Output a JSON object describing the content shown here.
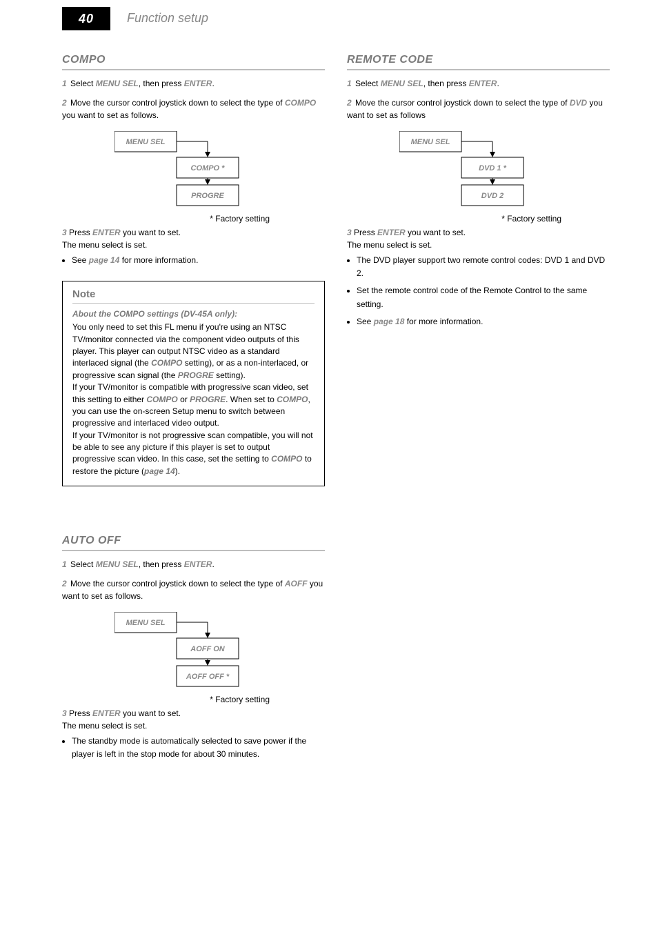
{
  "page_number": "40",
  "header_title": "Function setup",
  "factory_star": "* Factory setting",
  "sectionA": {
    "title": "COMPO",
    "step1_lead": "1",
    "step1": {
      "pre": "Select ",
      "menu": "MENU SEL",
      "mid": ", then press ",
      "button": "ENTER",
      "post": "."
    },
    "step2_lead": "2",
    "step2": {
      "pre": "Move the cursor control joystick down to select the type of ",
      "key": "COMPO",
      "post": " you want to set as follows."
    },
    "flow": {
      "n1": "MENU SEL",
      "n2": "COMPO *",
      "n3": "PROGRE"
    },
    "step3_lead": "3",
    "step3": {
      "pre": "Press ",
      "btn": "ENTER",
      "post": " you want to set."
    },
    "menu_set": "The menu select is set.",
    "bullet": {
      "pre": "See ",
      "ref": "page 14",
      "post": " for more information."
    }
  },
  "note": {
    "title": "Note",
    "sub": "About the COMPO settings (DV-45A only):",
    "p1_a": "You only need to set this FL menu if you're using an NTSC TV/monitor connected via the component video outputs of this player. This player can output NTSC video as a standard interlaced signal (the ",
    "p1_compo": "COMPO",
    "p1_b": " setting), or as a non-interlaced, or progressive scan signal (the ",
    "p1_progre": "PROGRE",
    "p1_c": " setting).",
    "p2_a": "If your TV/monitor is compatible with progressive scan video, set this setting to either ",
    "p2_compo": "COMPO",
    "p2_b": " or ",
    "p2_progre": "PROGRE",
    "p2_c": ". When set to ",
    "p2_compo2": "COMPO",
    "p2_d": ", you can use the on-screen Setup menu to switch between progressive and interlaced video output.",
    "p3_a": "If your TV/monitor is not progressive scan compatible, you will not be able to see any picture if this player is set to output progressive scan video. In this case, set the setting to ",
    "p3_compo": "COMPO",
    "p3_b": " to restore the picture (",
    "p3_ref": "page 14",
    "p3_c": ")."
  },
  "sectionB": {
    "title": "AUTO OFF",
    "step1_lead": "1",
    "step1": {
      "pre": "Select ",
      "menu": "MENU SEL",
      "mid": ", then press ",
      "button": "ENTER",
      "post": "."
    },
    "step2_lead": "2",
    "step2": {
      "pre": "Move the cursor control joystick down to select the type of ",
      "key": "AOFF",
      "post": " you want to set as follows."
    },
    "flow": {
      "n1": "MENU SEL",
      "n2": "AOFF ON",
      "n3": "AOFF OFF *"
    },
    "step3_lead": "3",
    "step3": {
      "pre": "Press ",
      "btn": "ENTER",
      "post": " you want to set."
    },
    "menu_set": "The menu select is set.",
    "bullet": "The standby mode is automatically selected to save power if the player is left in the stop mode for about 30 minutes."
  },
  "sectionC": {
    "title": "REMOTE CODE",
    "step1_lead": "1",
    "step1": {
      "pre": "Select ",
      "menu": "MENU SEL",
      "mid": ", then press ",
      "button": "ENTER",
      "post": "."
    },
    "step2_lead": "2",
    "step2": {
      "pre": "Move the cursor control joystick down to select the type of ",
      "key": "DVD",
      "post": " you want to set as follows"
    },
    "flow": {
      "n1": "MENU SEL",
      "n2": "DVD 1 *",
      "n3": "DVD 2"
    },
    "step3_lead": "3",
    "step3": {
      "pre": "Press ",
      "btn": "ENTER",
      "post": " you want to set."
    },
    "menu_set": "The menu select is set.",
    "bullets": {
      "b1": "The DVD player support two remote control codes: DVD 1 and DVD 2.",
      "b2": "Set the remote control code of the Remote Control to the same setting.",
      "b3_pre": "See ",
      "b3_ref": "page 18",
      "b3_post": " for more information."
    }
  }
}
